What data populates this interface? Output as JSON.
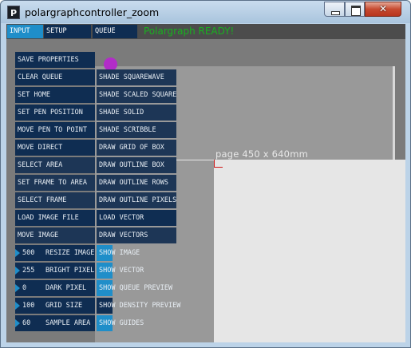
{
  "window": {
    "title": "polargraphcontroller_zoom",
    "app_icon": "P"
  },
  "tabs": [
    {
      "label": "INPUT",
      "active": true
    },
    {
      "label": "SETUP",
      "active": false
    },
    {
      "label": "QUEUE",
      "active": false
    }
  ],
  "status": "Polargraph READY!",
  "canvas": {
    "page_label": "page 450 x 640mm"
  },
  "col1": [
    "SAVE PROPERTIES",
    "CLEAR QUEUE",
    "SET HOME",
    "SET PEN POSITION",
    "MOVE PEN TO POINT",
    "MOVE DIRECT",
    "SELECT AREA",
    "SET FRAME TO AREA",
    "SELECT FRAME",
    "LOAD IMAGE FILE",
    "MOVE IMAGE"
  ],
  "col2": [
    "SHADE SQUAREWAVE",
    "SHADE SCALED SQUARE",
    "SHADE SOLID",
    "SHADE SCRIBBLE",
    "DRAW GRID OF BOX",
    "DRAW OUTLINE BOX",
    "DRAW OUTLINE ROWS",
    "DRAW OUTLINE PIXELS",
    "LOAD VECTOR",
    "DRAW VECTORS"
  ],
  "numbers": [
    {
      "value": "500",
      "label": "RESIZE IMAGE"
    },
    {
      "value": "255",
      "label": "BRIGHT PIXEL"
    },
    {
      "value": "0",
      "label": "DARK PIXEL"
    },
    {
      "value": "100",
      "label": "GRID SIZE"
    },
    {
      "value": "60",
      "label": "SAMPLE AREA"
    }
  ],
  "toggles": [
    {
      "label": "SHOW IMAGE",
      "on": true
    },
    {
      "label": "SHOW VECTOR",
      "on": true
    },
    {
      "label": "SHOW QUEUE PREVIEW",
      "on": true
    },
    {
      "label": "SHOW DENSITY PREVIEW",
      "on": false
    },
    {
      "label": "SHOW GUIDES",
      "on": true
    }
  ],
  "colors": {
    "accent": "#1f8ec9",
    "button": "#0f2d52",
    "status": "#19b020",
    "motor": "#b22cc8"
  }
}
